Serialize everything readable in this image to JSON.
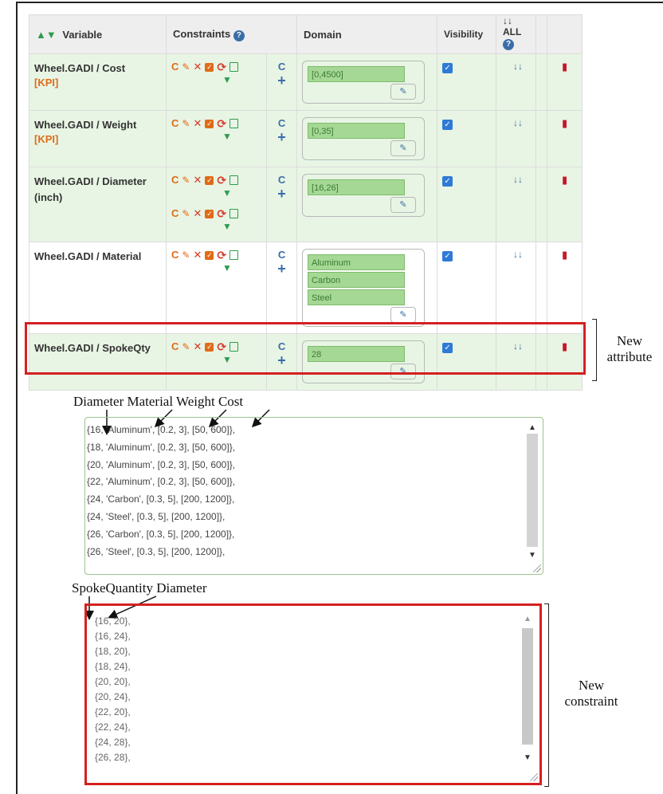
{
  "table": {
    "headers": {
      "variable": "Variable",
      "constraints": "Constraints",
      "domain": "Domain",
      "visibility": "Visibility",
      "all": "ALL"
    },
    "rows": [
      {
        "name": "Wheel.GADI / Cost",
        "tag": "[KPI]",
        "domain": [
          "[0,4500]"
        ],
        "constraint_sets": 1,
        "visible": true
      },
      {
        "name": "Wheel.GADI / Weight",
        "tag": "[KPI]",
        "domain": [
          "[0,35]"
        ],
        "constraint_sets": 1,
        "visible": true
      },
      {
        "name": "Wheel.GADI / Diameter (inch)",
        "tag": "",
        "domain": [
          "[16,26]"
        ],
        "constraint_sets": 2,
        "visible": true
      },
      {
        "name": "Wheel.GADI / Material",
        "tag": "",
        "domain": [
          "Aluminum",
          "Carbon",
          "Steel"
        ],
        "constraint_sets": 1,
        "visible": true
      },
      {
        "name": "Wheel.GADI / SpokeQty",
        "tag": "",
        "domain": [
          "28"
        ],
        "constraint_sets": 1,
        "visible": true
      }
    ]
  },
  "annotations": {
    "new_attribute": [
      "New",
      "attribute"
    ],
    "new_constraint": [
      "New",
      "constraint"
    ],
    "labels_top": "Diameter Material Weight Cost",
    "labels_bottom": "SpokeQuantity Diameter"
  },
  "constraint_table_1": [
    "{16, 'Aluminum', [0.2, 3], [50, 600]},",
    "{18, 'Aluminum', [0.2, 3], [50, 600]},",
    "{20, 'Aluminum', [0.2, 3], [50, 600]},",
    "{22, 'Aluminum', [0.2, 3], [50, 600]},",
    "{24, 'Carbon', [0.3, 5], [200, 1200]},",
    "{24, 'Steel', [0.3, 5], [200, 1200]},",
    "{26, 'Carbon', [0.3, 5], [200, 1200]},",
    "{26, 'Steel', [0.3, 5], [200, 1200]},"
  ],
  "constraint_table_2": [
    "{16, 20},",
    "{16, 24},",
    "{18, 20},",
    "{18, 24},",
    "{20, 20},",
    "{20, 24},",
    "{22, 20},",
    "{22, 24},",
    "{24, 28},",
    "{26, 28},"
  ],
  "icons": {
    "sort": "sort-icon",
    "help": "help-icon",
    "expand_all": "chevron-double-down-icon",
    "trash": "trash-icon",
    "filter": "filter-icon",
    "edit": "edit-icon"
  },
  "colors": {
    "row_green": "#e8f5e4",
    "accent_orange": "#e06b17",
    "accent_blue": "#3a6ea8",
    "highlight_red": "#d42020",
    "domain_green": "#a5d894"
  }
}
